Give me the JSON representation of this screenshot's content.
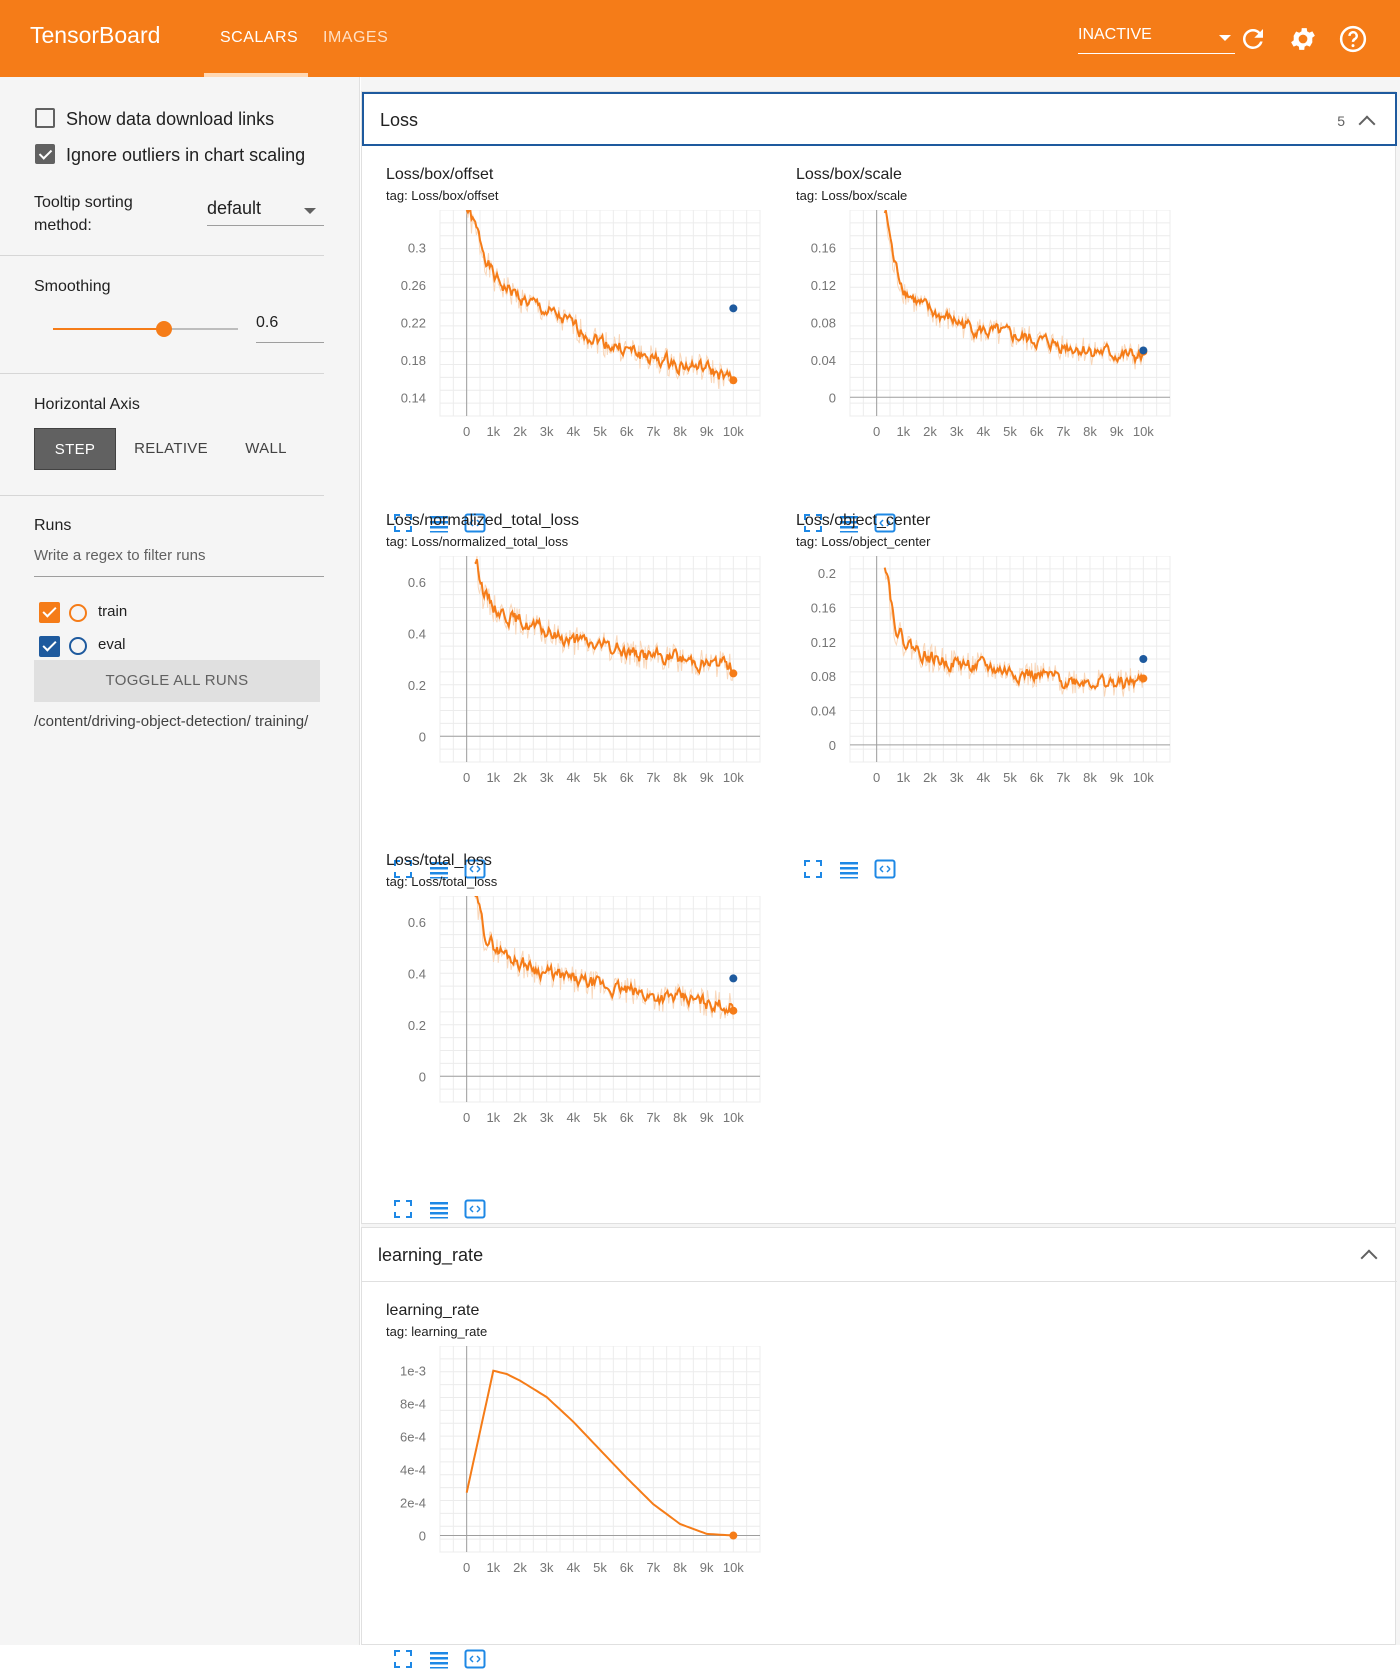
{
  "app": {
    "title": "TensorBoard",
    "tabs": [
      "SCALARS",
      "IMAGES"
    ],
    "active_tab": "SCALARS",
    "run_status": "INACTIVE",
    "accent": "#f57c18"
  },
  "toolbar_icons": [
    "refresh-icon",
    "settings-icon",
    "help-icon"
  ],
  "sidebar": {
    "show_download": {
      "label": "Show data download links",
      "checked": false
    },
    "ignore_outliers": {
      "label": "Ignore outliers in chart scaling",
      "checked": true
    },
    "tooltip": {
      "label": "Tooltip sorting method:",
      "value": "default"
    },
    "smoothing": {
      "label": "Smoothing",
      "value": "0.6",
      "level": 0.6
    },
    "horizontal_axis": {
      "label": "Horizontal Axis",
      "options": [
        "STEP",
        "RELATIVE",
        "WALL"
      ],
      "selected": "STEP"
    },
    "runs": {
      "label": "Runs",
      "filter_placeholder": "Write a regex to filter runs",
      "items": [
        {
          "name": "train",
          "checked": true,
          "color": "#f57c18"
        },
        {
          "name": "eval",
          "checked": true,
          "color": "#1e5a9e"
        }
      ],
      "toggle_label": "TOGGLE ALL RUNS",
      "logdir": "/content/driving-object-detection/ training/"
    }
  },
  "sections": [
    {
      "title": "Loss",
      "count": "5"
    },
    {
      "title": "learning_rate"
    }
  ],
  "chart_data": [
    {
      "type": "line",
      "title": "Loss/box/offset",
      "tag": "tag: Loss/box/offset",
      "x_ticks": [
        "0",
        "1k",
        "2k",
        "3k",
        "4k",
        "5k",
        "6k",
        "7k",
        "8k",
        "9k",
        "10k"
      ],
      "xlim": [
        -1000,
        11000
      ],
      "y_ticks": [
        "0.14",
        "0.18",
        "0.22",
        "0.26",
        "0.3"
      ],
      "ylim": [
        0.12,
        0.34
      ],
      "series": [
        {
          "name": "train",
          "color": "#f57c18",
          "x": [
            0,
            400,
            1000,
            2000,
            3000,
            4000,
            5000,
            6000,
            7000,
            8000,
            9000,
            10000
          ],
          "y": [
            0.34,
            0.31,
            0.265,
            0.245,
            0.23,
            0.215,
            0.2,
            0.19,
            0.18,
            0.175,
            0.17,
            0.155
          ]
        },
        {
          "name": "eval",
          "color": "#1e5a9e",
          "x": [
            10000
          ],
          "y": [
            0.235
          ]
        }
      ]
    },
    {
      "type": "line",
      "title": "Loss/box/scale",
      "tag": "tag: Loss/box/scale",
      "x_ticks": [
        "0",
        "1k",
        "2k",
        "3k",
        "4k",
        "5k",
        "6k",
        "7k",
        "8k",
        "9k",
        "10k"
      ],
      "xlim": [
        -1000,
        11000
      ],
      "y_ticks": [
        "0",
        "0.04",
        "0.08",
        "0.12",
        "0.16"
      ],
      "ylim": [
        -0.02,
        0.2
      ],
      "series": [
        {
          "name": "train",
          "color": "#f57c18",
          "x": [
            300,
            600,
            1000,
            1500,
            2000,
            3000,
            4000,
            5000,
            6000,
            7000,
            8000,
            9000,
            10000
          ],
          "y": [
            0.2,
            0.14,
            0.115,
            0.1,
            0.09,
            0.08,
            0.07,
            0.065,
            0.06,
            0.055,
            0.05,
            0.045,
            0.042
          ]
        },
        {
          "name": "eval",
          "color": "#1e5a9e",
          "x": [
            10000
          ],
          "y": [
            0.05
          ]
        }
      ]
    },
    {
      "type": "line",
      "title": "Loss/normalized_total_loss",
      "tag": "tag: Loss/normalized_total_loss",
      "x_ticks": [
        "0",
        "1k",
        "2k",
        "3k",
        "4k",
        "5k",
        "6k",
        "7k",
        "8k",
        "9k",
        "10k"
      ],
      "xlim": [
        -1000,
        11000
      ],
      "y_ticks": [
        "0",
        "0.2",
        "0.4",
        "0.6"
      ],
      "ylim": [
        -0.1,
        0.7
      ],
      "series": [
        {
          "name": "train",
          "color": "#f57c18",
          "x": [
            300,
            600,
            1000,
            2000,
            3000,
            4000,
            5000,
            6000,
            7000,
            8000,
            9000,
            10000
          ],
          "y": [
            0.7,
            0.55,
            0.5,
            0.44,
            0.4,
            0.37,
            0.35,
            0.33,
            0.31,
            0.3,
            0.285,
            0.27
          ]
        }
      ]
    },
    {
      "type": "line",
      "title": "Loss/object_center",
      "tag": "tag: Loss/object_center",
      "x_ticks": [
        "0",
        "1k",
        "2k",
        "3k",
        "4k",
        "5k",
        "6k",
        "7k",
        "8k",
        "9k",
        "10k"
      ],
      "xlim": [
        -1000,
        11000
      ],
      "y_ticks": [
        "0",
        "0.04",
        "0.08",
        "0.12",
        "0.16",
        "0.2"
      ],
      "ylim": [
        -0.02,
        0.22
      ],
      "series": [
        {
          "name": "train",
          "color": "#f57c18",
          "x": [
            300,
            600,
            1000,
            2000,
            3000,
            4000,
            5000,
            6000,
            7000,
            8000,
            9000,
            10000
          ],
          "y": [
            0.22,
            0.14,
            0.12,
            0.1,
            0.095,
            0.09,
            0.085,
            0.08,
            0.075,
            0.075,
            0.07,
            0.075
          ]
        },
        {
          "name": "eval",
          "color": "#1e5a9e",
          "x": [
            10000
          ],
          "y": [
            0.1
          ]
        }
      ]
    },
    {
      "type": "line",
      "title": "Loss/total_loss",
      "tag": "tag: Loss/total_loss",
      "x_ticks": [
        "0",
        "1k",
        "2k",
        "3k",
        "4k",
        "5k",
        "6k",
        "7k",
        "8k",
        "9k",
        "10k"
      ],
      "xlim": [
        -1000,
        11000
      ],
      "y_ticks": [
        "0",
        "0.2",
        "0.4",
        "0.6"
      ],
      "ylim": [
        -0.1,
        0.7
      ],
      "series": [
        {
          "name": "train",
          "color": "#f57c18",
          "x": [
            300,
            600,
            1000,
            2000,
            3000,
            4000,
            5000,
            6000,
            7000,
            8000,
            9000,
            10000
          ],
          "y": [
            0.7,
            0.55,
            0.5,
            0.44,
            0.4,
            0.37,
            0.35,
            0.33,
            0.31,
            0.3,
            0.285,
            0.27
          ]
        },
        {
          "name": "eval",
          "color": "#1e5a9e",
          "x": [
            10000
          ],
          "y": [
            0.38
          ]
        }
      ]
    },
    {
      "type": "line",
      "title": "learning_rate",
      "tag": "tag: learning_rate",
      "x_ticks": [
        "0",
        "1k",
        "2k",
        "3k",
        "4k",
        "5k",
        "6k",
        "7k",
        "8k",
        "9k",
        "10k"
      ],
      "xlim": [
        -1000,
        11000
      ],
      "y_ticks": [
        "0",
        "2e-4",
        "4e-4",
        "6e-4",
        "8e-4",
        "1e-3"
      ],
      "ylim": [
        -0.0001,
        0.00115
      ],
      "series": [
        {
          "name": "train",
          "color": "#f57c18",
          "x": [
            0,
            1000,
            1500,
            2000,
            3000,
            4000,
            5000,
            6000,
            7000,
            8000,
            9000,
            10000
          ],
          "y": [
            0.00026,
            0.001,
            0.00098,
            0.00094,
            0.00084,
            0.00069,
            0.00052,
            0.00035,
            0.00019,
            7e-05,
            1e-05,
            0
          ]
        }
      ]
    }
  ]
}
